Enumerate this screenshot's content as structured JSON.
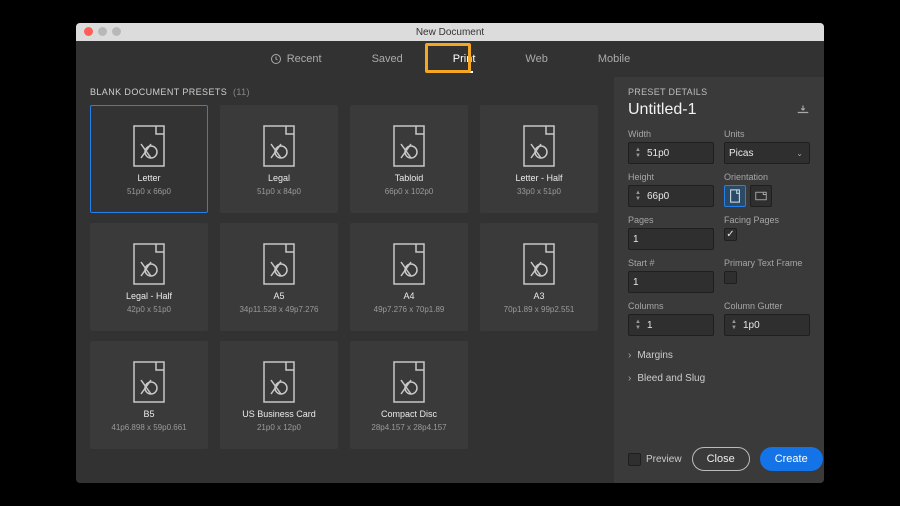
{
  "window": {
    "title": "New Document"
  },
  "tabs": {
    "recent": "Recent",
    "saved": "Saved",
    "print": "Print",
    "web": "Web",
    "mobile": "Mobile",
    "active": "print"
  },
  "presets": {
    "label": "BLANK DOCUMENT PRESETS",
    "count": "(11)",
    "items": [
      {
        "name": "Letter",
        "dims": "51p0 x 66p0",
        "selected": true
      },
      {
        "name": "Legal",
        "dims": "51p0 x 84p0"
      },
      {
        "name": "Tabloid",
        "dims": "66p0 x 102p0"
      },
      {
        "name": "Letter - Half",
        "dims": "33p0 x 51p0"
      },
      {
        "name": "Legal - Half",
        "dims": "42p0 x 51p0"
      },
      {
        "name": "A5",
        "dims": "34p11.528 x 49p7.276"
      },
      {
        "name": "A4",
        "dims": "49p7.276 x 70p1.89"
      },
      {
        "name": "A3",
        "dims": "70p1.89 x 99p2.551"
      },
      {
        "name": "B5",
        "dims": "41p6.898 x 59p0.661"
      },
      {
        "name": "US Business Card",
        "dims": "21p0 x 12p0"
      },
      {
        "name": "Compact Disc",
        "dims": "28p4.157 x 28p4.157"
      }
    ]
  },
  "details": {
    "header": "PRESET DETAILS",
    "docname": "Untitled-1",
    "width_label": "Width",
    "width": "51p0",
    "height_label": "Height",
    "height": "66p0",
    "units_label": "Units",
    "units": "Picas",
    "orientation_label": "Orientation",
    "pages_label": "Pages",
    "pages": "1",
    "facing_label": "Facing Pages",
    "facing_checked": true,
    "start_label": "Start #",
    "start": "1",
    "ptf_label": "Primary Text Frame",
    "ptf_checked": false,
    "columns_label": "Columns",
    "columns": "1",
    "gutter_label": "Column Gutter",
    "gutter": "1p0",
    "margins_label": "Margins",
    "bleed_label": "Bleed and Slug",
    "preview_label": "Preview",
    "close": "Close",
    "create": "Create"
  }
}
